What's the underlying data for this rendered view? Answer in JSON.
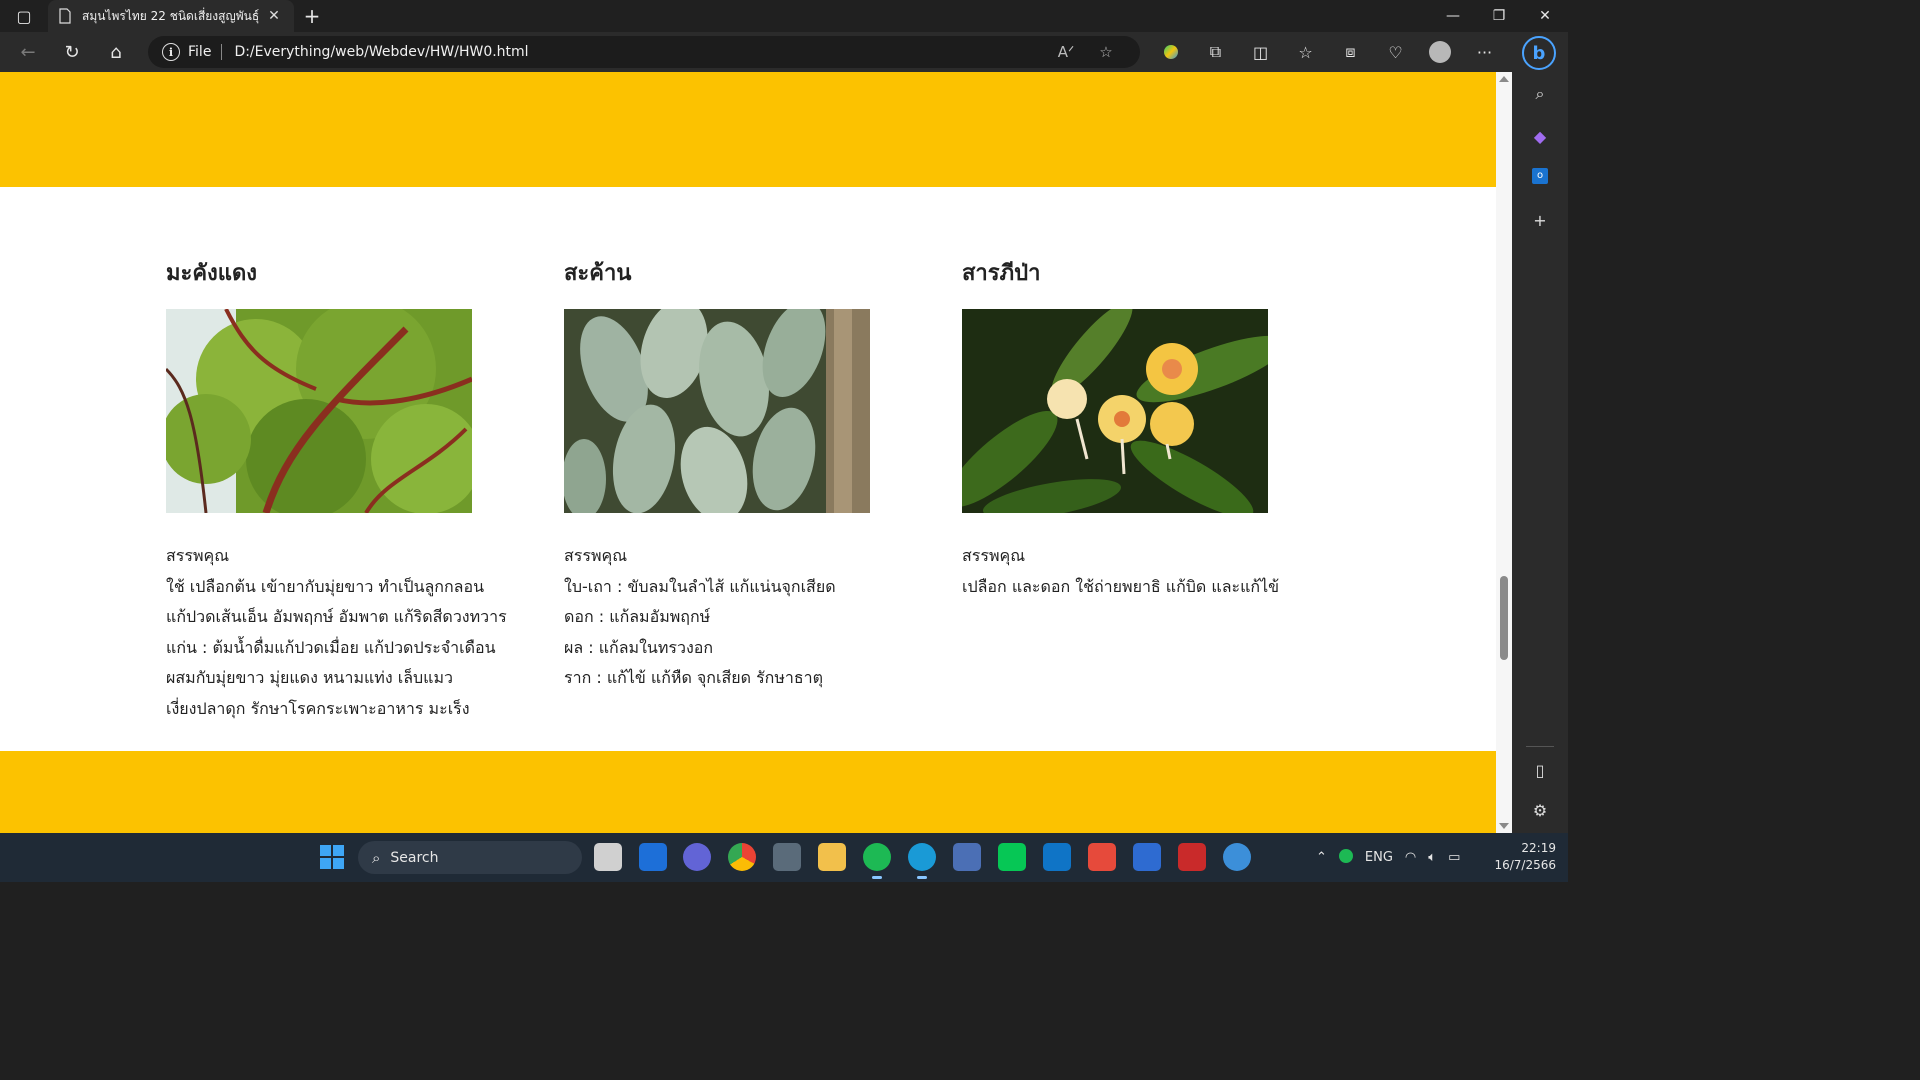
{
  "browser": {
    "tab_title": "สมุนไพรไทย 22 ชนิดเสี่ยงสูญพันธุ์",
    "address_scheme": "File",
    "address_url": "D:/Everything/web/Webdev/HW/HW0.html"
  },
  "cards": [
    {
      "name": "มะคังแดง",
      "benefit_heading": "สรรพคุณ",
      "lines": [
        "ใช้ เปลือกต้น เข้ายากับมุ่ยขาว ทำเป็นลูกกลอน",
        "แก้ปวดเส้นเอ็น อัมพฤกษ์ อัมพาต แก้ริดสีดวงทวาร",
        "แก่น : ต้มน้ำดื่มแก้ปวดเมื่อย แก้ปวดประจำเดือน",
        "ผสมกับมุ่ยขาว มุ่ยแดง หนามแท่ง เล็บแมว",
        "เงี่ยงปลาดุก รักษาโรคกระเพาะอาหาร มะเร็ง"
      ]
    },
    {
      "name": "สะค้าน",
      "benefit_heading": "สรรพคุณ",
      "lines": [
        "ใบ-เถา : ขับลมในลำไส้ แก้แน่นจุกเสียด",
        "ดอก : แก้ลมอัมพฤกษ์",
        "ผล : แก้ลมในทรวงอก",
        "ราก : แก้ไข้ แก้หืด จุกเสียด รักษาธาตุ"
      ]
    },
    {
      "name": "สารภีป่า",
      "benefit_heading": "สรรพคุณ",
      "lines": [
        "เปลือก และดอก ใช้ถ่ายพยาธิ แก้บิด และแก้ไข้"
      ]
    }
  ],
  "taskbar": {
    "search_label": "Search",
    "language": "ENG",
    "time": "22:19",
    "date": "16/7/2566"
  },
  "colors": {
    "band": "#fcc200",
    "accent": "#3ea6f5"
  }
}
